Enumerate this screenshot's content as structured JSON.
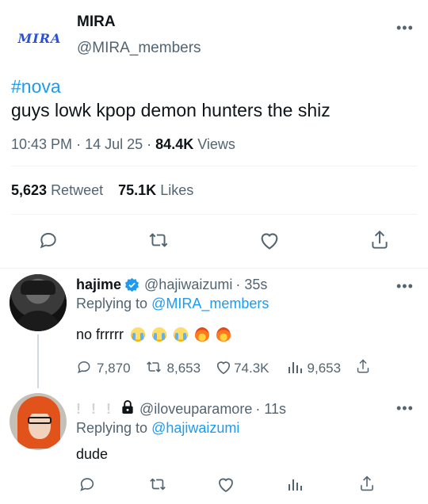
{
  "main_tweet": {
    "display_name": "MIRA",
    "handle": "@MIRA_members",
    "avatar_text": "MIRA",
    "hashtag": "#nova",
    "text": "guys lowk kpop demon hunters the shiz",
    "time": "10:43 PM",
    "sep1": "·",
    "date": "14 Jul 25",
    "sep2": "·",
    "views_count": "84.4K",
    "views_label": "Views",
    "retweets_count": "5,623",
    "retweets_label": "Retweet",
    "likes_count": "75.1K",
    "likes_label": "Likes"
  },
  "reply1": {
    "display_name": "hajime",
    "handle": "@hajiwaizumi",
    "time": "· 35s",
    "replying_label": "Replying to",
    "replying_handle": "@MIRA_members",
    "text": "no frrrrr",
    "reply_count": "7,870",
    "retweet_count": "8,653",
    "like_count": "74.3K",
    "view_count": "9,653"
  },
  "reply2": {
    "display_name": "! ! !",
    "handle": "@iloveuparamore",
    "time": "· 11s",
    "replying_label": "Replying to",
    "replying_handle": "@hajiwaizumi",
    "text": "dude"
  },
  "colors": {
    "accent": "#1d9bf0",
    "text": "#0f1419",
    "secondary": "#536471",
    "divider": "#eff3f4"
  },
  "icons": [
    "more-icon",
    "reply-icon",
    "retweet-icon",
    "like-icon",
    "share-icon",
    "views-icon",
    "verified-icon",
    "lock-icon"
  ]
}
